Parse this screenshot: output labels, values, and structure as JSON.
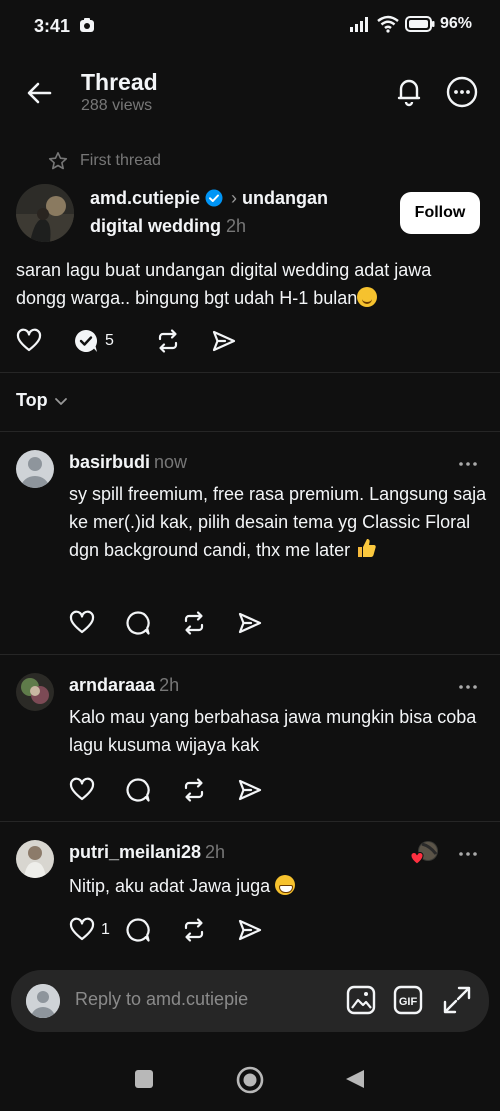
{
  "status": {
    "time": "3:41",
    "battery": "96%"
  },
  "header": {
    "title": "Thread",
    "views": "288 views"
  },
  "first_thread": "First thread",
  "post": {
    "author": "amd.cutiepie",
    "community_line1": "undangan",
    "community_line2": "digital wedding",
    "time": "2h",
    "follow": "Follow",
    "text": "saran lagu buat undangan digital wedding adat jawa dongg warga.. bingung bgt udah H-1 bulan",
    "reply_count": "5"
  },
  "sort": {
    "label": "Top"
  },
  "replies": [
    {
      "user": "basirbudi",
      "time": "now",
      "text": "sy spill freemium, free rasa premium. Langsung saja ke mer(.)id kak, pilih desain tema yg Classic Floral dgn background candi, thx me later",
      "likes": ""
    },
    {
      "user": "arndaraaa",
      "time": "2h",
      "text": "Kalo mau yang berbahasa jawa mungkin bisa coba lagu kusuma wijaya kak",
      "likes": ""
    },
    {
      "user": "putri_meilani28",
      "time": "2h",
      "text": "Nitip, aku adat Jawa juga",
      "likes": "1"
    }
  ],
  "composer": {
    "placeholder": "Reply to amd.cutiepie"
  },
  "icons": {
    "back": "arrow-left-icon",
    "bell": "bell-icon",
    "more": "more-circle-icon",
    "like": "heart-icon",
    "comment": "comment-icon",
    "repost": "repost-icon",
    "share": "send-icon",
    "image": "image-icon",
    "gif": "gif-icon",
    "expand": "expand-icon"
  },
  "colors": {
    "background": "#101010",
    "verified": "#0095f6",
    "muted": "#777777",
    "like_red": "#ff3040"
  }
}
